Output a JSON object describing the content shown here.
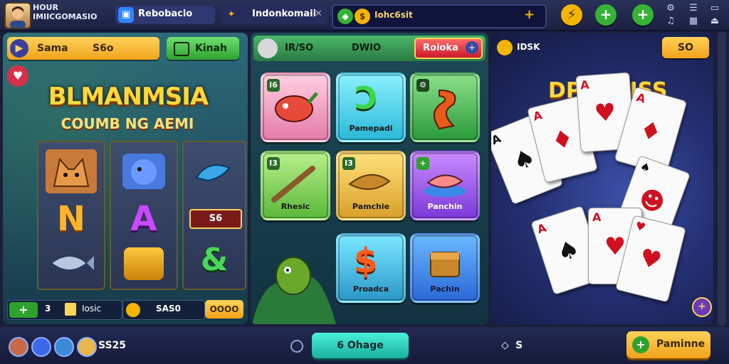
{
  "topbar": {
    "brand_line1": "HOUR",
    "brand_line2": "IMIICGOMASIO",
    "tab1_label": "Rebobacio",
    "tab2_label": "Indonkomaii",
    "balance_label": "Iohc6sit",
    "close_glyph": "✕",
    "plus_glyph": "+",
    "icons": [
      "lightning-icon",
      "plus-icon",
      "plus-icon"
    ],
    "colors": {
      "accent_yellow": "#f4b400",
      "accent_green": "#36b336"
    }
  },
  "left": {
    "mode_label": "Sama",
    "bet_label": "S6o",
    "play_button": "Kinah",
    "title_line1": "BLMANMSIA",
    "title_line2": "COUMB NG AEMI",
    "reel_symbols": [
      "N",
      "A",
      "&"
    ],
    "small_value": "S6",
    "footer_counter": "3",
    "footer_text": "Iosic",
    "footer_amount": "SAS0",
    "footer_button": "OOOO"
  },
  "mid": {
    "header_text1": "IR/SO",
    "header_text2": "DWIO",
    "header_button": "Roioka",
    "tiles": [
      {
        "badge": "I6",
        "label": ""
      },
      {
        "badge": "",
        "label": "Pamepadi"
      },
      {
        "badge": "",
        "label": ""
      },
      {
        "badge": "I3",
        "label": "Rhesic"
      },
      {
        "badge": "I3",
        "label": "Pamchie"
      },
      {
        "badge": "+",
        "label": "Panchin"
      },
      {
        "badge": "",
        "label": "Proadca"
      },
      {
        "badge": "",
        "label": "Pachin"
      }
    ]
  },
  "right": {
    "header_text": "IDSK",
    "header_button": "SO",
    "title": "DPACHISS",
    "cards": [
      "A",
      "A",
      "A",
      "A",
      "A",
      "A"
    ]
  },
  "bottom": {
    "score": "SS25",
    "center_button": "6 Ohage",
    "right_small": "S",
    "action_button": "Paminne"
  }
}
